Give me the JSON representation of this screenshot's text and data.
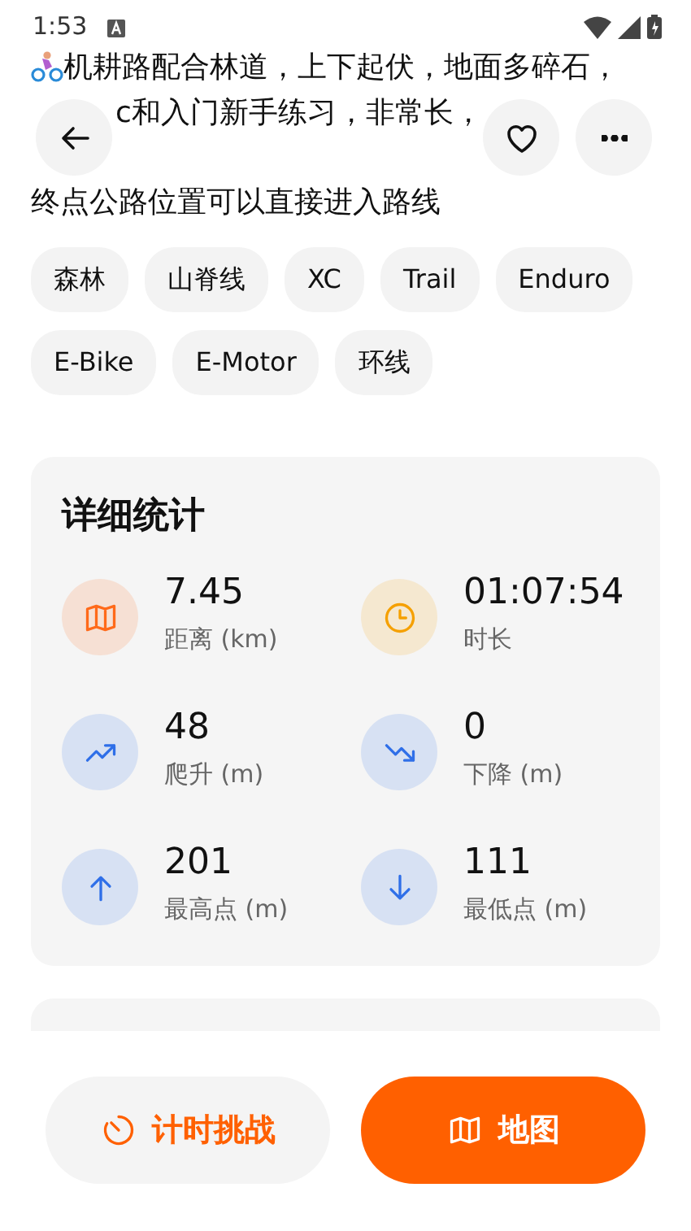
{
  "status_bar": {
    "time": "1:53"
  },
  "description": [
    {
      "segments": [
        "机耕路配合林道，上下起伏，地面多碎石，"
      ]
    },
    {
      "segments": [
        "c和入门新手练习，非常长，"
      ]
    },
    {
      "segments": [
        "终点公路位置可以直接进入路线"
      ]
    }
  ],
  "tags": [
    "森林",
    "山脊线",
    "XC",
    "Trail",
    "Enduro",
    "E-Bike",
    "E-Motor",
    "环线"
  ],
  "stats": {
    "title": "详细统计",
    "items": [
      {
        "kind": "map",
        "color": "#ff6a1a",
        "value": "7.45",
        "label": "距离 (km)"
      },
      {
        "kind": "clock",
        "color": "#f5a000",
        "value": "01:07:54",
        "label": "时长"
      },
      {
        "kind": "climb",
        "color": "#2f6fe8",
        "value": "48",
        "label": "爬升 (m)"
      },
      {
        "kind": "descent",
        "color": "#2f6fe8",
        "value": "0",
        "label": "下降 (m)"
      },
      {
        "kind": "up",
        "color": "#2f6fe8",
        "value": "201",
        "label": "最高点 (m)"
      },
      {
        "kind": "down",
        "color": "#2f6fe8",
        "value": "111",
        "label": "最低点 (m)"
      }
    ]
  },
  "actions": [
    {
      "kind": "timer",
      "label": "计时挑战"
    },
    {
      "kind": "map",
      "label": "地图"
    }
  ]
}
